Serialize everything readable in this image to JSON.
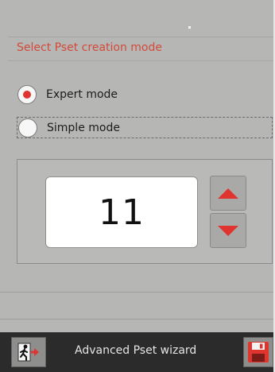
{
  "header": {
    "title": "Select Pset creation mode"
  },
  "mode_options": [
    {
      "label": "Expert mode",
      "selected": true
    },
    {
      "label": "Simple mode",
      "selected": false
    }
  ],
  "value_panel": {
    "value": "11",
    "increment_icon": "triangle-up-icon",
    "decrement_icon": "triangle-down-icon"
  },
  "bottom_bar": {
    "title": "Advanced Pset wizard",
    "exit_icon": "exit-door-icon",
    "save_icon": "floppy-disk-icon"
  },
  "colors": {
    "accent": "#e0342f",
    "title_text": "#d34a3a",
    "background": "#b6b6b4",
    "bottom_bar": "#2b2b2b"
  }
}
